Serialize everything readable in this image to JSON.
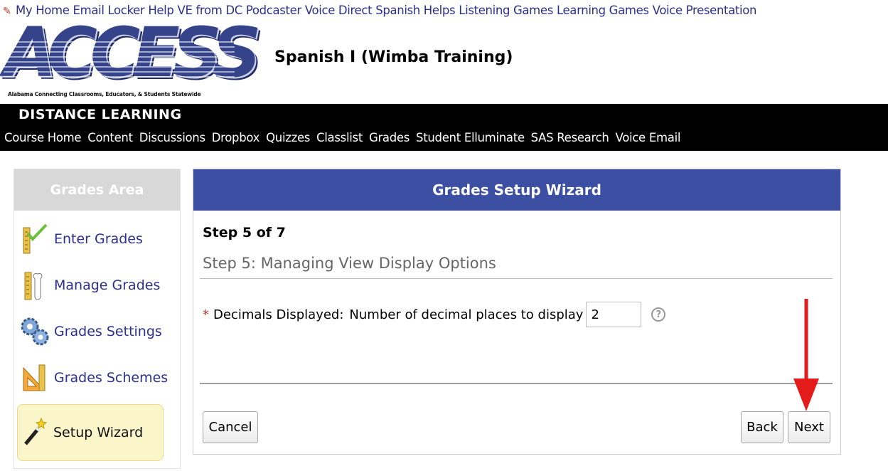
{
  "top_links": [
    "My Home",
    "Email Locker",
    "Help",
    "VE from DC",
    "Podcaster",
    "Voice Direct",
    "Spanish Helps",
    "Listening Games",
    "Learning Games",
    "Voice Presentation"
  ],
  "logo": {
    "text": "ACCESS",
    "subtitle": "Alabama Connecting Classrooms, Educators, & Students Statewide"
  },
  "course_title": "Spanish I (Wimba Training)",
  "banner": {
    "title": "DISTANCE LEARNING",
    "nav": [
      "Course Home",
      "Content",
      "Discussions",
      "Dropbox",
      "Quizzes",
      "Classlist",
      "Grades",
      "Student Elluminate",
      "SAS Research",
      "Voice Email"
    ]
  },
  "sidebar": {
    "title": "Grades Area",
    "items": [
      {
        "label": "Enter Grades",
        "icon": "ruler-check-icon"
      },
      {
        "label": "Manage Grades",
        "icon": "ruler-wrench-icon"
      },
      {
        "label": "Grades Settings",
        "icon": "gears-icon"
      },
      {
        "label": "Grades Schemes",
        "icon": "triangle-ruler-icon"
      },
      {
        "label": "Setup Wizard",
        "icon": "magic-wand-icon"
      }
    ]
  },
  "wizard": {
    "title": "Grades Setup Wizard",
    "step_of": "Step 5 of 7",
    "step_title": "Step 5: Managing View Display Options",
    "field": {
      "required_mark": "*",
      "label": "Decimals Displayed:",
      "description": "Number of decimal places to display",
      "value": "2"
    },
    "buttons": {
      "cancel": "Cancel",
      "back": "Back",
      "next": "Next"
    }
  },
  "colors": {
    "panel_header": "#3c4fa3",
    "link": "#2d2f8f",
    "highlight": "#fbf6c9",
    "arrow": "#e31b1b"
  }
}
